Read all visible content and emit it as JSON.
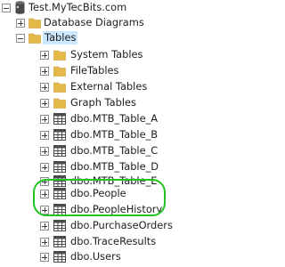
{
  "tree": {
    "server": "Test.MyTecBits.com",
    "database_diagrams": "Database Diagrams",
    "tables": "Tables",
    "system_tables": "System Tables",
    "file_tables": "FileTables",
    "external_tables": "External Tables",
    "graph_tables": "Graph Tables",
    "table_items": [
      "dbo.MTB_Table_A",
      "dbo.MTB_Table_B",
      "dbo.MTB_Table_C",
      "dbo.MTB_Table_D",
      "dbo.MTB_Table_E",
      "dbo.People",
      "dbo.PeopleHistory",
      "dbo.PurchaseOrders",
      "dbo.TraceResults",
      "dbo.Users"
    ]
  },
  "colors": {
    "highlight": "#22c522",
    "folder": "#e5b84a",
    "table_icon": "#4a4a4a"
  }
}
